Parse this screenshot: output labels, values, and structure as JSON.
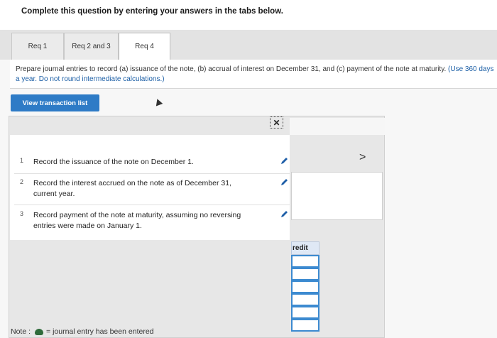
{
  "heading": "Complete this question by entering your answers in the tabs below.",
  "tabs": [
    {
      "label": "Req 1"
    },
    {
      "label": "Req 2 and 3"
    },
    {
      "label": "Req 4"
    }
  ],
  "active_tab": "Req 4",
  "instructions": {
    "main": "Prepare journal entries to record (a) issuance of the note, (b) accrual of interest on December 31, and (c) payment of the note at maturity.",
    "note": "(Use 360 days a year. Do not round intermediate calculations.)"
  },
  "view_button": "View transaction list",
  "transactions": [
    {
      "num": "1",
      "text": "Record the issuance of the note on December 1."
    },
    {
      "num": "2",
      "text": "Record the interest accrued on the note as of December 31, current year."
    },
    {
      "num": "3",
      "text": "Record payment of the note at maturity, assuming no reversing entries were made on January 1."
    }
  ],
  "close_symbol": "✕",
  "next_symbol": ">",
  "credit_header": "redit",
  "legend": {
    "prefix": "Note :",
    "text": "= journal entry has been entered"
  },
  "colors": {
    "accent": "#2e7bc6",
    "pencil": "#1f5fa8",
    "entered_dot": "#2f6b3b"
  }
}
